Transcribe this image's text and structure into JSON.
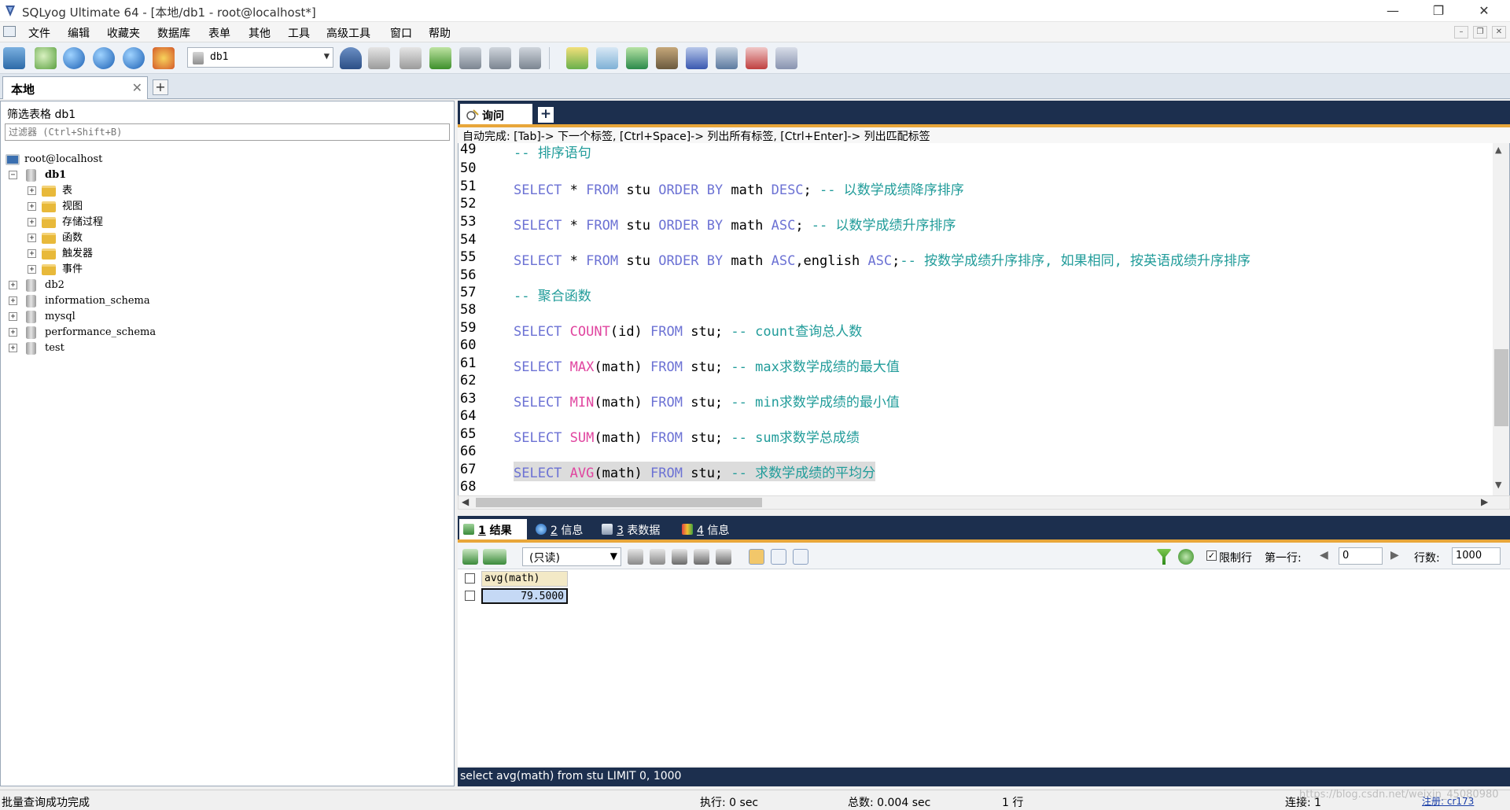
{
  "window": {
    "title": "SQLyog Ultimate 64 - [本地/db1 - root@localhost*]",
    "controls": [
      "—",
      "❐",
      "✕"
    ]
  },
  "menu": [
    "文件",
    "编辑",
    "收藏夹",
    "数据库",
    "表单",
    "其他",
    "工具",
    "高级工具",
    "窗口",
    "帮助"
  ],
  "toolbar": {
    "database": "db1"
  },
  "connection_tab": {
    "label": "本地",
    "close": "✕",
    "add": "+"
  },
  "object_browser": {
    "filter_label": "筛选表格  db1",
    "filter_placeholder": "过滤器 (Ctrl+Shift+B)",
    "root": "root@localhost",
    "db_expanded": "db1",
    "db1_children": [
      "表",
      "视图",
      "存储过程",
      "函数",
      "触发器",
      "事件"
    ],
    "other_dbs": [
      "db2",
      "information_schema",
      "mysql",
      "performance_schema",
      "test"
    ]
  },
  "query_tab": {
    "label": "询问",
    "add": "+"
  },
  "autocomplete_hint": "自动完成: [Tab]-> 下一个标签, [Ctrl+Space]-> 列出所有标签, [Ctrl+Enter]-> 列出匹配标签",
  "editor": {
    "line_numbers": [
      "49",
      "50",
      "51",
      "52",
      "53",
      "54",
      "55",
      "56",
      "57",
      "58",
      "59",
      "60",
      "61",
      "62",
      "63",
      "64",
      "65",
      "66",
      "67",
      "68"
    ],
    "lines": {
      "l49": {
        "c1": "-- 排序语句"
      },
      "l51": {
        "k1": "SELECT",
        "t1": " * ",
        "k2": "FROM",
        "t2": " stu ",
        "k3": "ORDER BY",
        "t3": " math ",
        "k4": "DESC",
        "t4": "; ",
        "c1": "-- 以数学成绩降序排序"
      },
      "l53": {
        "k1": "SELECT",
        "t1": " * ",
        "k2": "FROM",
        "t2": " stu ",
        "k3": "ORDER BY",
        "t3": " math ",
        "k4": "ASC",
        "t4": "; ",
        "c1": "-- 以数学成绩升序排序"
      },
      "l55": {
        "k1": "SELECT",
        "t1": " * ",
        "k2": "FROM",
        "t2": " stu ",
        "k3": "ORDER BY",
        "t3": " math ",
        "k4": "ASC",
        "t4": ",english ",
        "k5": "ASC",
        "t5": ";",
        "c1": "-- 按数学成绩升序排序, 如果相同, 按英语成绩升序排序"
      },
      "l57": {
        "c1": "-- 聚合函数"
      },
      "l59": {
        "k1": "SELECT",
        "f1": " COUNT",
        "t1": "(id) ",
        "k2": "FROM",
        "t2": " stu; ",
        "c1": "-- count查询总人数"
      },
      "l61": {
        "k1": "SELECT",
        "f1": " MAX",
        "t1": "(math) ",
        "k2": "FROM",
        "t2": " stu; ",
        "c1": "-- max求数学成绩的最大值"
      },
      "l63": {
        "k1": "SELECT",
        "f1": " MIN",
        "t1": "(math) ",
        "k2": "FROM",
        "t2": " stu; ",
        "c1": "-- min求数学成绩的最小值"
      },
      "l65": {
        "k1": "SELECT",
        "f1": " SUM",
        "t1": "(math) ",
        "k2": "FROM",
        "t2": " stu; ",
        "c1": "-- sum求数学总成绩"
      },
      "l67": {
        "k1": "SELECT",
        "f1": " AVG",
        "t1": "(math) ",
        "k2": "FROM",
        "t2": " stu; ",
        "c1": "-- 求数学成绩的平均分"
      }
    }
  },
  "result_tabs": [
    {
      "num": "1",
      "label": "结果"
    },
    {
      "num": "2",
      "label": "信息"
    },
    {
      "num": "3",
      "label": "表数据"
    },
    {
      "num": "4",
      "label": "信息"
    }
  ],
  "result_toolbar": {
    "mode": "(只读)",
    "limit_label": "限制行",
    "first_row_label": "第一行:",
    "first_row_value": "0",
    "rows_label": "行数:",
    "rows_value": "1000"
  },
  "result_grid": {
    "column": "avg(math)",
    "value": "79.5000"
  },
  "query_footer": "select avg(math) from stu LIMIT 0, 1000",
  "status": {
    "message": "批量查询成功完成",
    "exec": "执行: 0 sec",
    "total": "总数: 0.004 sec",
    "rows": "1 行",
    "connection": "连接: 1",
    "register": "注册: cr173",
    "watermark": "https://blog.csdn.net/weixin_45080980"
  },
  "colors": {
    "keyword": "#6c72d4",
    "function": "#e0459f",
    "comment": "#219c9a",
    "accent_dark": "#1c2f4e",
    "accent_orange": "#e8a63a"
  }
}
